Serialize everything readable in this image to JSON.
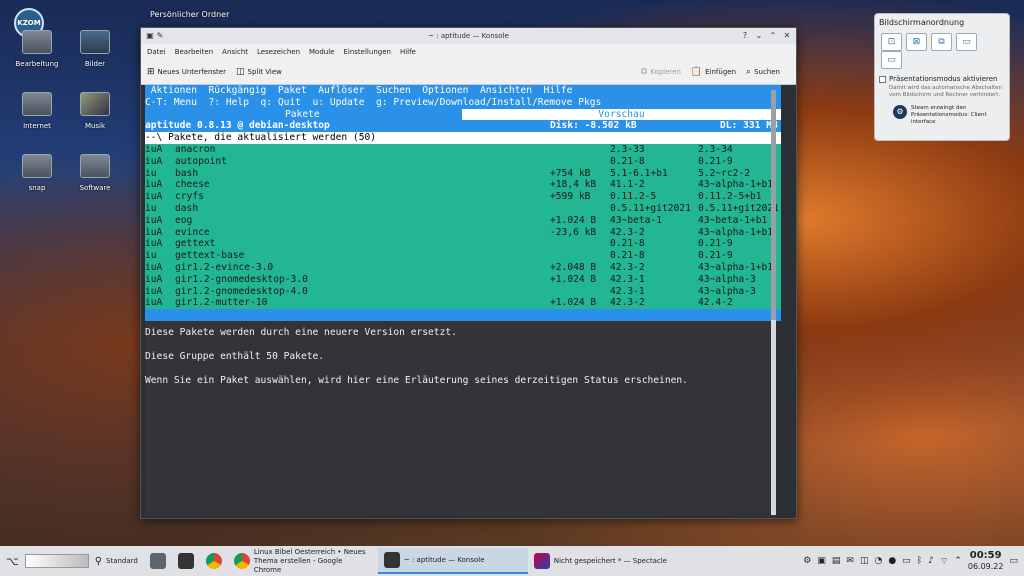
{
  "desktop": {
    "top_label": "Persönlicher Ordner",
    "logo": "KZOM",
    "icons": [
      "Bearbeitung",
      "Bilder",
      "Internet",
      "Musik",
      "snap",
      "Software"
    ]
  },
  "window": {
    "title": "~ : aptitude — Konsole",
    "menu": [
      "Datei",
      "Bearbeiten",
      "Ansicht",
      "Lesezeichen",
      "Module",
      "Einstellungen",
      "Hilfe"
    ],
    "toolbar": {
      "new_tab": "Neues Unterfenster",
      "split": "Split View",
      "copy": "Kopieren",
      "paste": "Einfügen",
      "search": "Suchen"
    }
  },
  "terminal": {
    "menu": " Aktionen  Rückgängig  Paket  Auflöser  Suchen  Optionen  Ansichten  Hilfe",
    "keys": "C-T: Menu  ?: Help  q: Quit  u: Update  g: Preview/Download/Install/Remove Pkgs",
    "tab_left": "Pakete",
    "tab_right": "Vorschau",
    "status_left": "aptitude 0.8.13 @ debian-desktop",
    "status_disk": "Disk: -8.502 kB",
    "status_dl": "DL: 331 MB",
    "group": "--\\ Pakete, die aktualisiert werden (50)",
    "packages": [
      {
        "flags": "iuA",
        "name": "anacron",
        "size": "",
        "cur": "2.3-33",
        "new": "2.3-34"
      },
      {
        "flags": "iuA",
        "name": "autopoint",
        "size": "",
        "cur": "0.21-8",
        "new": "0.21-9"
      },
      {
        "flags": "iu",
        "name": "bash",
        "size": "+754 kB",
        "cur": "5.1-6.1+b1",
        "new": "5.2~rc2-2"
      },
      {
        "flags": "iuA",
        "name": "cheese",
        "size": "+18,4 kB",
        "cur": "41.1-2",
        "new": "43~alpha-1+b1"
      },
      {
        "flags": "iuA",
        "name": "cryfs",
        "size": "+599 kB",
        "cur": "0.11.2-5",
        "new": "0.11.2-5+b1"
      },
      {
        "flags": "iu",
        "name": "dash",
        "size": "",
        "cur": "0.5.11+git2021",
        "new": "0.5.11+git2021"
      },
      {
        "flags": "iuA",
        "name": "eog",
        "size": "+1.024 B",
        "cur": "43~beta-1",
        "new": "43~beta-1+b1"
      },
      {
        "flags": "iuA",
        "name": "evince",
        "size": "-23,6 kB",
        "cur": "42.3-2",
        "new": "43~alpha-1+b1"
      },
      {
        "flags": "iuA",
        "name": "gettext",
        "size": "",
        "cur": "0.21-8",
        "new": "0.21-9"
      },
      {
        "flags": "iu",
        "name": "gettext-base",
        "size": "",
        "cur": "0.21-8",
        "new": "0.21-9"
      },
      {
        "flags": "iuA",
        "name": "gir1.2-evince-3.0",
        "size": "+2.048 B",
        "cur": "42.3-2",
        "new": "43~alpha-1+b1"
      },
      {
        "flags": "iuA",
        "name": "gir1.2-gnomedesktop-3.0",
        "size": "+1.024 B",
        "cur": "42.3-1",
        "new": "43~alpha-3"
      },
      {
        "flags": "iuA",
        "name": "gir1.2-gnomedesktop-4.0",
        "size": "",
        "cur": "42.3-1",
        "new": "43~alpha-3"
      },
      {
        "flags": "iuA",
        "name": "gir1.2-mutter-10",
        "size": "+1.024 B",
        "cur": "42.3-2",
        "new": "42.4-2"
      }
    ],
    "desc1": "Diese Pakete werden durch eine neuere Version ersetzt.",
    "desc2": "Diese Gruppe enthält 50 Pakete.",
    "desc3": "Wenn Sie ein Paket auswählen, wird hier eine Erläuterung seines derzeitigen Status erscheinen."
  },
  "popup": {
    "title": "Bildschirmanordnung",
    "checkbox": "Präsentationsmodus aktivieren",
    "hint": "Damit wird das automatische Abschalten vom Bildschirm und Rechner verhindert.",
    "steam_line1": "Steam erzwingt den",
    "steam_line2": "Präsentationsmodus: Client",
    "steam_line3": "interface"
  },
  "taskbar": {
    "standard": "Standard",
    "chrome_task_line1": "Linux Bibel Oesterreich • Neues",
    "chrome_task_line2": "Thema erstellen - Google Chrome",
    "konsole_task": "~ : aptitude — Konsole",
    "spectacle_task": "Nicht gespeichert * — Spectacle",
    "time": "00:59",
    "date": "06.09.22"
  }
}
